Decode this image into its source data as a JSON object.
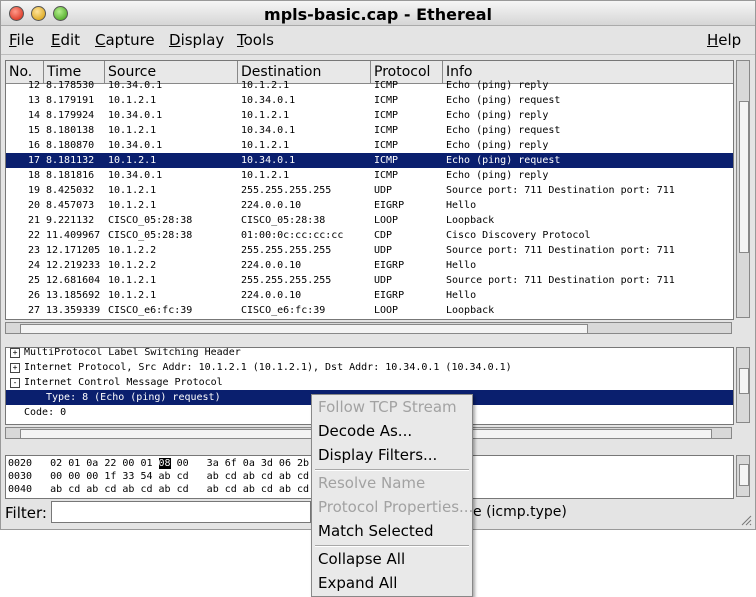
{
  "window": {
    "title": "mpls-basic.cap - Ethereal"
  },
  "menu": {
    "items": [
      {
        "ul": "F",
        "rest": "ile"
      },
      {
        "ul": "E",
        "rest": "dit"
      },
      {
        "ul": "C",
        "rest": "apture"
      },
      {
        "ul": "D",
        "rest": "isplay"
      },
      {
        "ul": "T",
        "rest": "ools"
      }
    ],
    "help": {
      "ul": "H",
      "rest": "elp"
    }
  },
  "packet_list": {
    "columns": [
      "No.",
      "Time",
      "Source",
      "Destination",
      "Protocol",
      "Info"
    ],
    "rows": [
      {
        "no": "12",
        "time": "8.178530",
        "src": "10.34.0.1",
        "dst": "10.1.2.1",
        "proto": "ICMP",
        "info": "Echo (ping) reply"
      },
      {
        "no": "13",
        "time": "8.179191",
        "src": "10.1.2.1",
        "dst": "10.34.0.1",
        "proto": "ICMP",
        "info": "Echo (ping) request"
      },
      {
        "no": "14",
        "time": "8.179924",
        "src": "10.34.0.1",
        "dst": "10.1.2.1",
        "proto": "ICMP",
        "info": "Echo (ping) reply"
      },
      {
        "no": "15",
        "time": "8.180138",
        "src": "10.1.2.1",
        "dst": "10.34.0.1",
        "proto": "ICMP",
        "info": "Echo (ping) request"
      },
      {
        "no": "16",
        "time": "8.180870",
        "src": "10.34.0.1",
        "dst": "10.1.2.1",
        "proto": "ICMP",
        "info": "Echo (ping) reply"
      },
      {
        "no": "17",
        "time": "8.181132",
        "src": "10.1.2.1",
        "dst": "10.34.0.1",
        "proto": "ICMP",
        "info": "Echo (ping) request",
        "selected": true
      },
      {
        "no": "18",
        "time": "8.181816",
        "src": "10.34.0.1",
        "dst": "10.1.2.1",
        "proto": "ICMP",
        "info": "Echo (ping) reply"
      },
      {
        "no": "19",
        "time": "8.425032",
        "src": "10.1.2.1",
        "dst": "255.255.255.255",
        "proto": "UDP",
        "info": "Source port: 711  Destination port: 711"
      },
      {
        "no": "20",
        "time": "8.457073",
        "src": "10.1.2.1",
        "dst": "224.0.0.10",
        "proto": "EIGRP",
        "info": "Hello"
      },
      {
        "no": "21",
        "time": "9.221132",
        "src": "CISCO_05:28:38",
        "dst": "CISCO_05:28:38",
        "proto": "LOOP",
        "info": "Loopback"
      },
      {
        "no": "22",
        "time": "11.409967",
        "src": "CISCO_05:28:38",
        "dst": "01:00:0c:cc:cc:cc",
        "proto": "CDP",
        "info": "Cisco Discovery Protocol"
      },
      {
        "no": "23",
        "time": "12.171205",
        "src": "10.1.2.2",
        "dst": "255.255.255.255",
        "proto": "UDP",
        "info": "Source port: 711  Destination port: 711"
      },
      {
        "no": "24",
        "time": "12.219233",
        "src": "10.1.2.2",
        "dst": "224.0.0.10",
        "proto": "EIGRP",
        "info": "Hello"
      },
      {
        "no": "25",
        "time": "12.681604",
        "src": "10.1.2.1",
        "dst": "255.255.255.255",
        "proto": "UDP",
        "info": "Source port: 711  Destination port: 711"
      },
      {
        "no": "26",
        "time": "13.185692",
        "src": "10.1.2.1",
        "dst": "224.0.0.10",
        "proto": "EIGRP",
        "info": "Hello"
      },
      {
        "no": "27",
        "time": "13.359339",
        "src": "CISCO_e6:fc:39",
        "dst": "CISCO_e6:fc:39",
        "proto": "LOOP",
        "info": "Loopback"
      }
    ]
  },
  "packet_tree": {
    "rows": [
      {
        "exp": "+",
        "text": "MultiProtocol Label Switching Header"
      },
      {
        "exp": "+",
        "text": "Internet Protocol, Src Addr: 10.1.2.1 (10.1.2.1), Dst Addr: 10.34.0.1 (10.34.0.1)"
      },
      {
        "exp": "-",
        "text": "Internet Control Message Protocol"
      },
      {
        "exp": "",
        "text": "Type: 8 (Echo (ping) request)",
        "selected": true
      },
      {
        "exp": "",
        "text": "Code: 0"
      }
    ]
  },
  "hex": {
    "rows": [
      {
        "pre": "0020   02 01 0a 22 00 01 ",
        "hl": "08",
        "post": " 00   3a 6f 0a 3d 06 2b 00"
      },
      {
        "pre": "0030   00 00 00 1f 33 54 ab cd   ab cd ab cd ab cd ab",
        "hl": "",
        "post": ""
      },
      {
        "pre": "0040   ab cd ab cd ab cd ab cd   ab cd ab cd ab cd ab",
        "hl": "",
        "post": ""
      }
    ]
  },
  "filter": {
    "label": "Filter:",
    "value": "",
    "status": "e (icmp.type)"
  },
  "context_menu": {
    "items": [
      {
        "label": "Follow TCP Stream",
        "enabled": false
      },
      {
        "label": "Decode As...",
        "enabled": true
      },
      {
        "label": "Display Filters...",
        "enabled": true
      },
      {
        "label": "Resolve Name",
        "enabled": false
      },
      {
        "label": "Protocol Properties...",
        "enabled": false
      },
      {
        "label": "Match Selected",
        "enabled": true
      },
      {
        "label": "Collapse All",
        "enabled": true
      },
      {
        "label": "Expand All",
        "enabled": true
      }
    ]
  },
  "colors": {
    "selection": "#0a1f6e",
    "disabled_text": "#a2a2a2"
  },
  "icons": [
    "close-icon",
    "minimize-icon",
    "zoom-icon",
    "expand-icon",
    "collapse-icon",
    "resize-grip-icon"
  ]
}
